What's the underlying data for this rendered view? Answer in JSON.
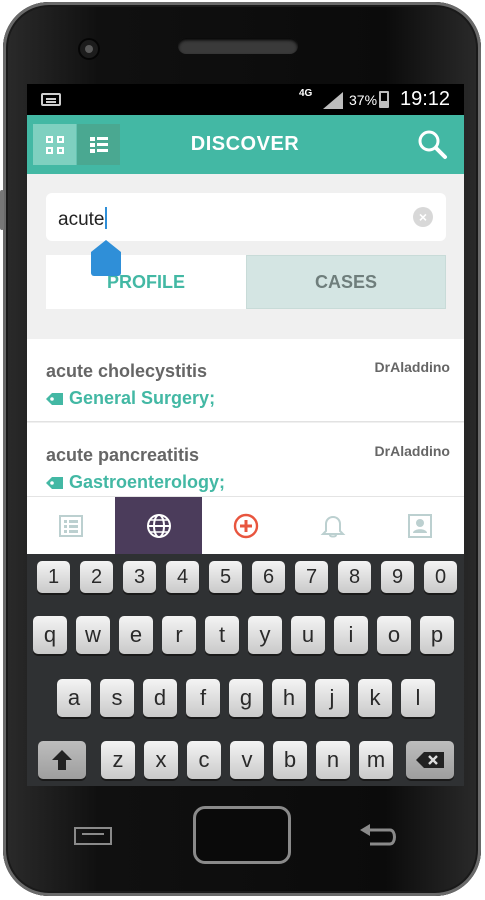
{
  "status_bar": {
    "network": "4G",
    "battery_percent": "37%",
    "time": "19:12",
    "icons": [
      "keyboard-icon",
      "signal-icon",
      "battery-icon"
    ]
  },
  "app_bar": {
    "title": "DISCOVER",
    "view_toggle": [
      "grid-view-icon",
      "list-view-icon"
    ],
    "accent_color": "#43b8a4"
  },
  "search": {
    "value": "acute"
  },
  "tabs": [
    {
      "label": "PROFILE",
      "active": true
    },
    {
      "label": "CASES",
      "active": false
    }
  ],
  "results": [
    {
      "title": "acute cholecystitis",
      "author": "DrAladdino",
      "tag": "General Surgery;"
    },
    {
      "title": "acute pancreatitis",
      "author": "DrAladdino",
      "tag": "Gastroenterology;"
    }
  ],
  "bottom_nav": [
    {
      "icon": "feed-icon",
      "active": false
    },
    {
      "icon": "globe-icon",
      "active": true
    },
    {
      "icon": "add-case-icon",
      "active": false
    },
    {
      "icon": "bell-icon",
      "active": false
    },
    {
      "icon": "profile-icon",
      "active": false
    }
  ],
  "keyboard": {
    "row_numbers": [
      "1",
      "2",
      "3",
      "4",
      "5",
      "6",
      "7",
      "8",
      "9",
      "0"
    ],
    "row_top": [
      "q",
      "w",
      "e",
      "r",
      "t",
      "y",
      "u",
      "i",
      "o",
      "p"
    ],
    "row_middle": [
      "a",
      "s",
      "d",
      "f",
      "g",
      "h",
      "j",
      "k",
      "l"
    ],
    "row_bottom": [
      "z",
      "x",
      "c",
      "v",
      "b",
      "n",
      "m"
    ],
    "shift_icon": "shift-icon",
    "backspace_icon": "backspace-icon"
  }
}
